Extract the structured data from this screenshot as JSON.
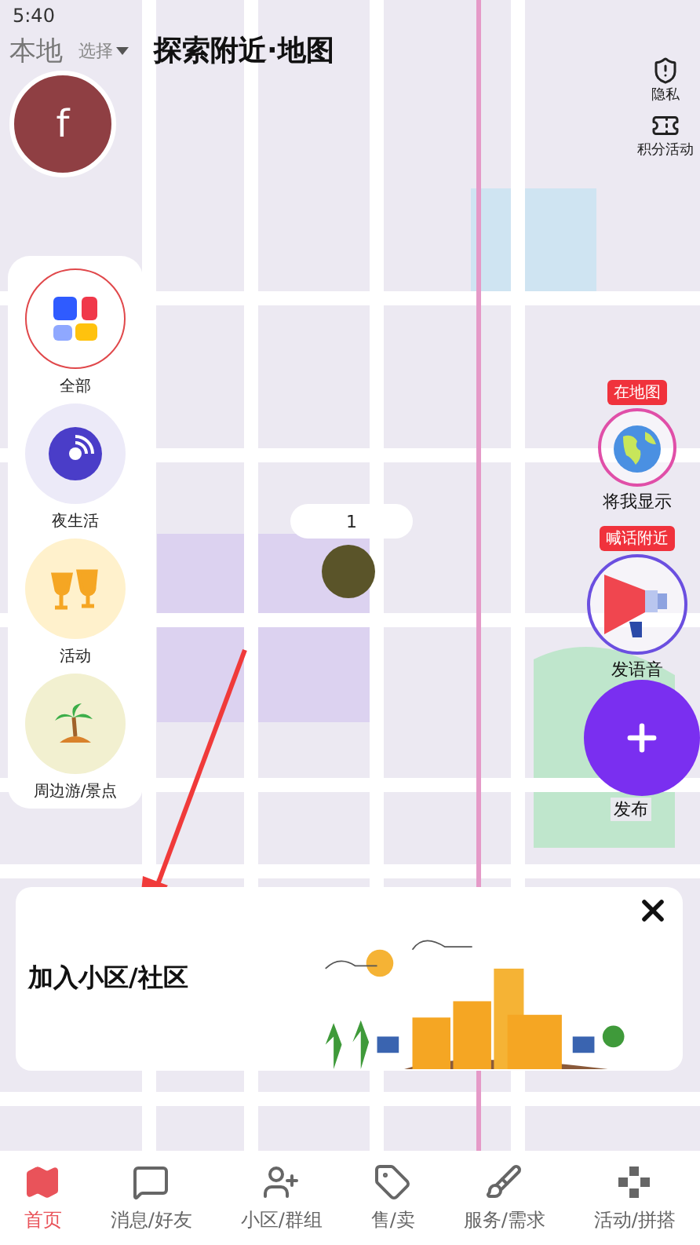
{
  "status_bar": {
    "time": "5:40"
  },
  "header": {
    "region": "本地",
    "region_picker": "选择",
    "title": "探索附近·地图"
  },
  "avatar": {
    "letter": "f"
  },
  "top_right": [
    {
      "label": "隐私",
      "kind": "shield"
    },
    {
      "label": "积分活动",
      "kind": "ticket"
    }
  ],
  "categories": [
    {
      "label": "全部",
      "kind": "grid",
      "selected": true
    },
    {
      "label": "夜生活",
      "kind": "disc",
      "selected": false
    },
    {
      "label": "活动",
      "kind": "cheers",
      "selected": false
    },
    {
      "label": "周边游/景点",
      "kind": "palm",
      "selected": false
    }
  ],
  "map_marker": {
    "count": "1"
  },
  "actions": [
    {
      "badge": "在地图",
      "label": "将我显示",
      "kind": "globe"
    },
    {
      "badge": "喊话附近",
      "label": "发语音",
      "kind": "megaphone"
    }
  ],
  "publish": {
    "label": "发布"
  },
  "banner": {
    "title": "加入小区/社区"
  },
  "tabs": [
    {
      "label": "首页",
      "kind": "map",
      "selected": true
    },
    {
      "label": "消息/好友",
      "kind": "message",
      "selected": false
    },
    {
      "label": "小区/群组",
      "kind": "users",
      "selected": false
    },
    {
      "label": "售/卖",
      "kind": "tag",
      "selected": false
    },
    {
      "label": "服务/需求",
      "kind": "broom",
      "selected": false
    },
    {
      "label": "活动/拼搭",
      "kind": "game",
      "selected": false
    }
  ]
}
